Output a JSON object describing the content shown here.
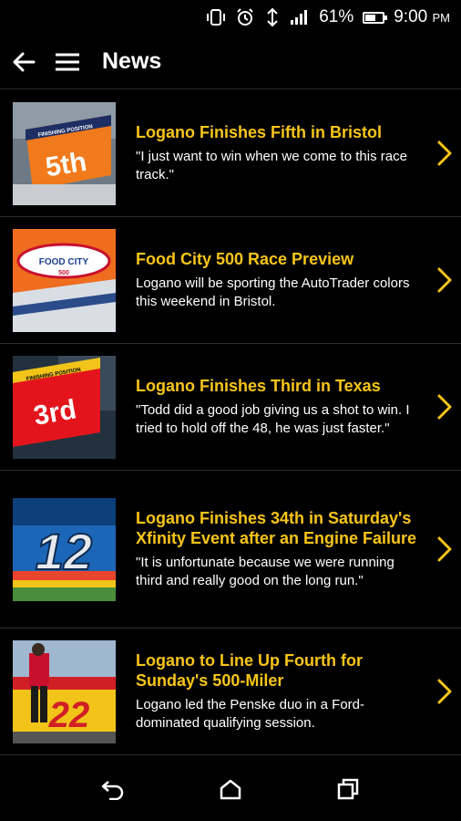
{
  "status_bar": {
    "battery_percent_text": "61%",
    "battery_level": 0.61,
    "time": "9:00",
    "ampm": "PM"
  },
  "app_bar": {
    "title": "News"
  },
  "news": [
    {
      "headline": "Logano Finishes Fifth in Bristol",
      "summary": "\"I just want to win when we come to this race track.\"",
      "thumb_text": "5th",
      "thumb_caption": "FINISHING POSITION"
    },
    {
      "headline": "Food City 500 Race Preview",
      "summary": "Logano will be sporting the AutoTrader colors this weekend in Bristol.",
      "thumb_text": "FOOD CITY",
      "thumb_caption": "500"
    },
    {
      "headline": "Logano Finishes Third in Texas",
      "summary": "\"Todd did a good job giving us a shot to win. I tried to hold off the 48, he was just faster.\"",
      "thumb_text": "3rd",
      "thumb_caption": "FINISHING POSITION"
    },
    {
      "headline": "Logano Finishes 34th in Saturday's Xfinity Event after an Engine Failure",
      "summary": "\"It is unfortunate because we were running third and really good on the long run.\"",
      "thumb_text": "12"
    },
    {
      "headline": "Logano to Line Up Fourth for Sunday's 500-Miler",
      "summary": "Logano led the Penske duo in a Ford-dominated qualifying session.",
      "thumb_text": "22"
    }
  ],
  "icons": {
    "back": "back-arrow-icon",
    "menu": "hamburger-menu-icon",
    "chevron": "chevron-right-icon",
    "nav_back": "nav-back-icon",
    "nav_home": "nav-home-icon",
    "nav_recents": "nav-recents-icon"
  },
  "colors": {
    "accent": "#f8c51a",
    "background": "#000000"
  }
}
